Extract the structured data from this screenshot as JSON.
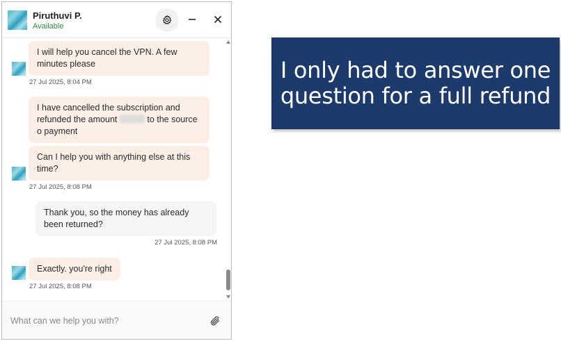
{
  "chat": {
    "agent": {
      "name": "Piruthuvi P.",
      "status": "Available",
      "status_color": "#2e8b3e"
    },
    "header_icons": [
      "gear-icon",
      "minimize-icon",
      "close-icon"
    ],
    "messages": [
      {
        "from": "agent",
        "text": "I will help you cancel the VPN. A few minutes please",
        "timestamp": "27 Jul 2025, 8:04 PM"
      },
      {
        "from": "agent",
        "text_before": "I have cancelled the subscription and refunded the amount",
        "text_after": "to the source o payment"
      },
      {
        "from": "agent",
        "text": "Can I help you with anything else at this time?",
        "timestamp": "27 Jul 2025, 8:08 PM"
      },
      {
        "from": "user",
        "text": "Thank you, so the money has already been returned?",
        "timestamp": "27 Jul 2025, 8:08 PM"
      },
      {
        "from": "agent",
        "text": "Exactly. you're right",
        "timestamp": "27 Jul 2025, 8:08 PM"
      }
    ],
    "composer": {
      "placeholder": "What can we help you with?",
      "value": ""
    }
  },
  "caption": {
    "text": "I only had to answer one question for a full refund",
    "background": "#1c3a6b",
    "text_color": "#ffffff"
  }
}
